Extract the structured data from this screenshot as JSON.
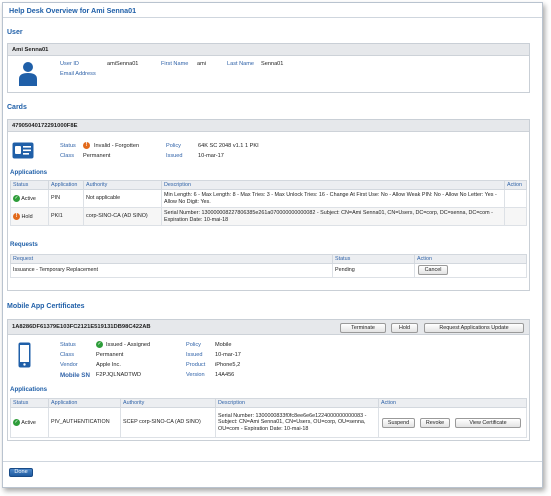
{
  "page": {
    "title": "Help Desk Overview for Ami Senna01"
  },
  "user": {
    "section_title": "User",
    "header": "Ami Senna01",
    "user_id_label": "User ID",
    "user_id": "amiSenna01",
    "first_name_label": "First Name",
    "first_name": "ami",
    "last_name_label": "Last Name",
    "last_name": "Senna01",
    "email_label": "Email Address",
    "email": ""
  },
  "cards": {
    "section_title": "Cards",
    "card_id": "47905040172291000F8E",
    "status_label": "Status",
    "status": "Invalid - Forgotten",
    "class_label": "Class",
    "class": "Permanent",
    "policy_label": "Policy",
    "policy": "64K SC 2048 v1.1 1 PKI",
    "issued_label": "Issued",
    "issued": "10-mar-17",
    "applications_title": "Applications",
    "app_headers": [
      "Status",
      "Application",
      "Authority",
      "Description",
      "Action"
    ],
    "applications": [
      {
        "status": "Active",
        "application": "PIN",
        "authority": "Not applicable",
        "description": "Min Length: 6 - Max Length: 8 - Max Tries: 3 - Max Unlock Tries: 16 - Change At First Use: No - Allow Weak PIN: No - Allow No Letter: Yes - Allow No Digit: Yes.",
        "action": ""
      },
      {
        "status": "Hold",
        "application": "PKI1",
        "authority": "corp-SINO-CA (AD SINO)",
        "description": "Serial Number: 130000008227806385e261a070000000000082 - Subject: CN=Ami Senna01, CN=Users, DC=corp, DC=senna, DC=com - Expiration Date: 10-mai-18",
        "action": ""
      }
    ],
    "requests_title": "Requests",
    "req_headers": [
      "Request",
      "Status",
      "Action"
    ],
    "requests": [
      {
        "request": "Issuance - Temporary Replacement",
        "status": "Pending",
        "action_label": "Cancel"
      }
    ]
  },
  "mobile": {
    "section_title": "Mobile App Certificates",
    "cert_id": "1A8286DF61379E103FC2121E519131DB98C422AB",
    "terminate_label": "Terminate",
    "hold_label": "Hold",
    "request_update_label": "Request Applications Update",
    "status_label": "Status",
    "status": "Issued - Assigned",
    "class_label": "Class",
    "class": "Permanent",
    "vendor_label": "Vendor",
    "vendor": "Apple Inc.",
    "mobile_sn_label": "Mobile SN",
    "mobile_sn": "F2PJQLNADTWD",
    "policy_label": "Policy",
    "policy": "Mobile",
    "issued_label": "Issued",
    "issued": "10-mar-17",
    "product_label": "Product",
    "product": "iPhone5,2",
    "version_label": "Version",
    "version": "14A456",
    "applications_title": "Applications",
    "app_headers": [
      "Status",
      "Application",
      "Authority",
      "Description",
      "Action"
    ],
    "applications": [
      {
        "status": "Active",
        "application": "PIV_AUTHENTICATION",
        "authority": "SCEP corp-SINO-CA (AD SINO)",
        "description": "Serial Number: 1300000833f0fc8ee6e6e1224000000000083 - Subject: CN=Ami Senna01, CN=Users, OU=corp, OU=senna, OU=com - Expiration Date: 10-mai-18",
        "suspend_label": "Suspend",
        "revoke_label": "Revoke",
        "view_label": "View Certificate"
      }
    ]
  },
  "footer": {
    "done_label": "Done"
  },
  "colors": {
    "accent": "#1f5fa8",
    "label": "#2f62a8",
    "ok": "#2e9d3a",
    "warn": "#e26a1b",
    "panel_header": "#e6e8eb"
  },
  "icons": {
    "user": "user-silhouette-icon",
    "card": "id-card-icon",
    "mobile": "mobile-phone-icon",
    "status_ok": "check-circle-icon",
    "status_warn": "exclamation-circle-icon"
  }
}
